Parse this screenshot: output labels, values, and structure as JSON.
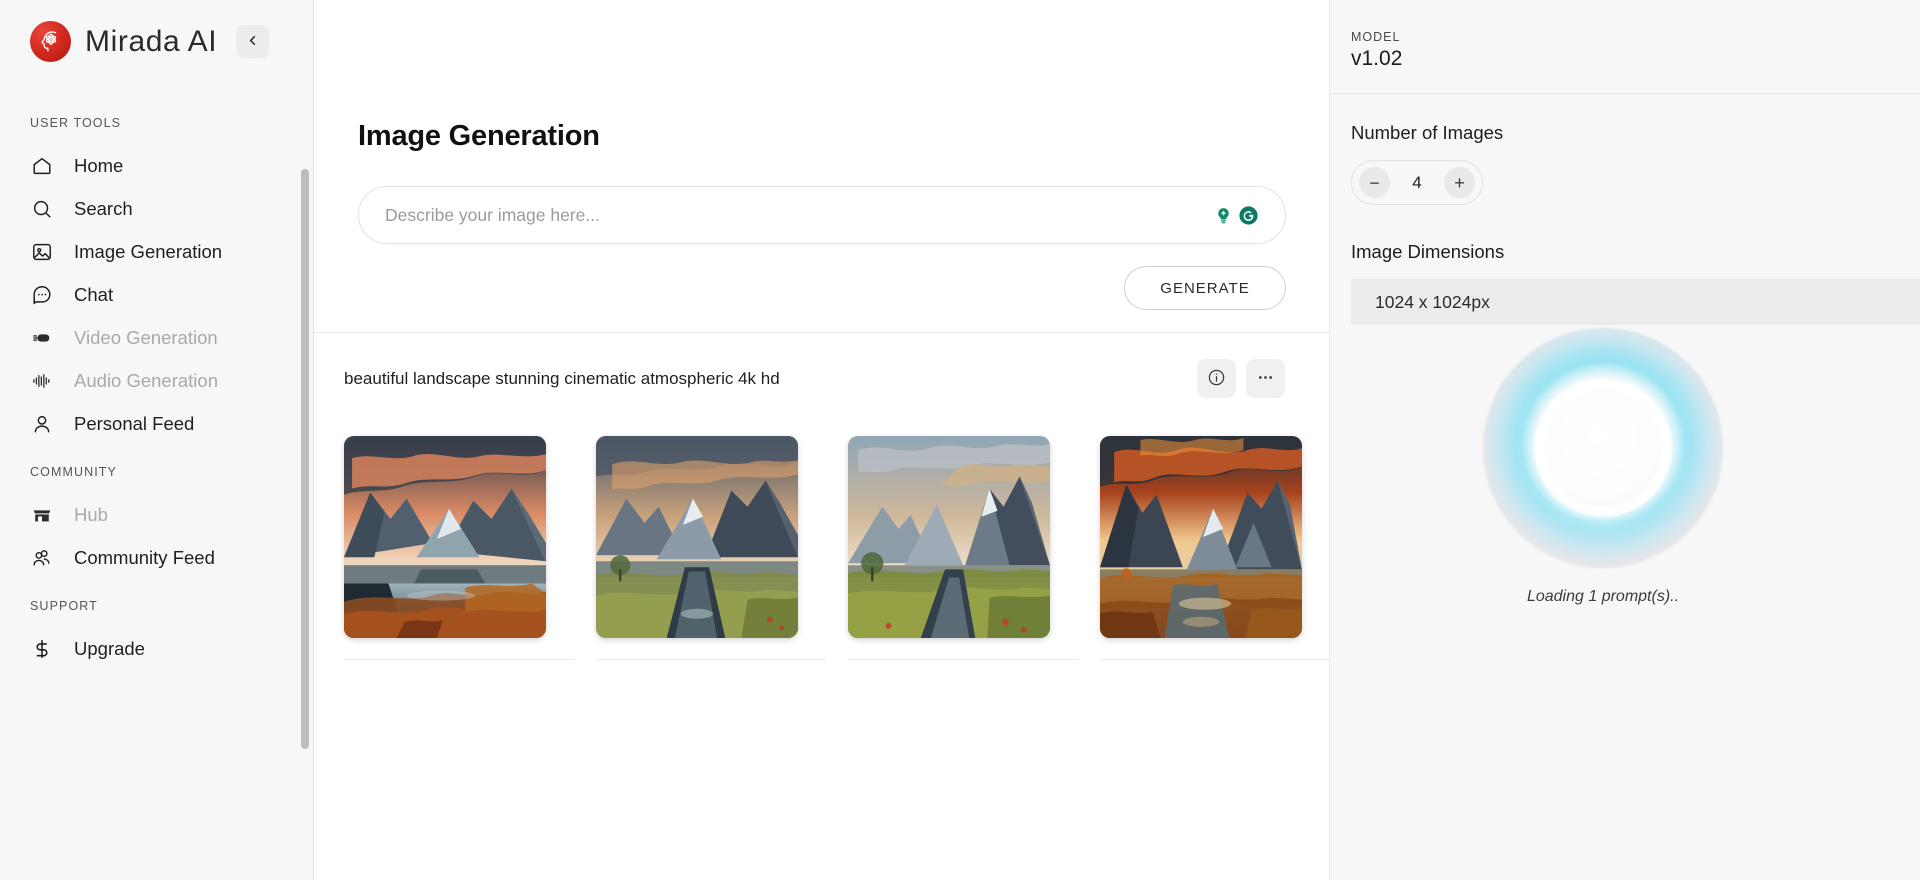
{
  "brand": {
    "name": "Mirada AI",
    "logo_icon": "brain-head-atom-icon",
    "collapse_icon": "chevron-left-icon",
    "accent_color": "#d42a20"
  },
  "sidebar": {
    "sections": [
      {
        "title": "USER TOOLS",
        "items": [
          {
            "label": "Home",
            "icon": "home-icon",
            "disabled": false
          },
          {
            "label": "Search",
            "icon": "search-icon",
            "disabled": false
          },
          {
            "label": "Image Generation",
            "icon": "image-icon",
            "disabled": false
          },
          {
            "label": "Chat",
            "icon": "chat-bubble-icon",
            "disabled": false
          },
          {
            "label": "Video Generation",
            "icon": "video-icon",
            "disabled": true
          },
          {
            "label": "Audio Generation",
            "icon": "audio-waveform-icon",
            "disabled": true
          },
          {
            "label": "Personal Feed",
            "icon": "user-icon",
            "disabled": false
          }
        ]
      },
      {
        "title": "COMMUNITY",
        "items": [
          {
            "label": "Hub",
            "icon": "storefront-icon",
            "disabled": true
          },
          {
            "label": "Community Feed",
            "icon": "users-group-icon",
            "disabled": false
          }
        ]
      },
      {
        "title": "SUPPORT",
        "items": [
          {
            "label": "Upgrade",
            "icon": "dollar-sign-icon",
            "disabled": false
          }
        ]
      }
    ]
  },
  "main": {
    "page_title": "Image Generation",
    "prompt_input": {
      "value": "",
      "placeholder": "Describe your image here..."
    },
    "prompt_tools": [
      {
        "icon": "lightbulb-sparkle-icon",
        "color": "#0e8a6e"
      },
      {
        "icon": "grammarly-g-icon",
        "color": "#0e8a6e"
      }
    ],
    "generate_button": "GENERATE",
    "result": {
      "prompt_text": "beautiful landscape stunning cinematic atmospheric 4k hd",
      "info_icon": "info-circle-icon",
      "more_icon": "ellipsis-horizontal-icon",
      "images": [
        {
          "alt": "mountain valley lake at sunset with orange slopes"
        },
        {
          "alt": "mountain range with winding river at dawn"
        },
        {
          "alt": "jagged peaks over green valley stream"
        },
        {
          "alt": "fiery sunset over peaks with reflecting pools"
        }
      ]
    }
  },
  "right_panel": {
    "model_label": "MODEL",
    "model_value": "v1.02",
    "number_of_images_label": "Number of Images",
    "number_of_images_value": "4",
    "decrement_label": "−",
    "increment_label": "+",
    "image_dimensions_label": "Image Dimensions",
    "image_dimensions_value": "1024 x 1024px",
    "loading_text": "Loading 1 prompt(s)..",
    "loader_colors": {
      "aura_cyan": "#78dcf0",
      "aura_pink": "#e8c8c8"
    }
  }
}
